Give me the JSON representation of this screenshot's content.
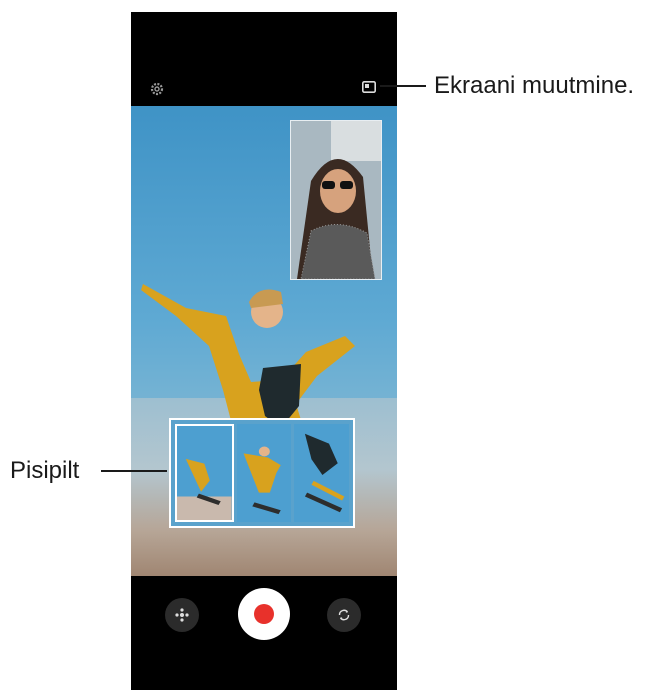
{
  "callouts": {
    "screen_switch": "Ekraani muutmine.",
    "thumbnail": "Pisipilt"
  },
  "icons": {
    "settings": "gear-icon",
    "screen_switch": "picture-in-picture-icon",
    "filter": "filter-icon",
    "record": "record-icon",
    "flip": "switch-camera-icon"
  },
  "colors": {
    "record": "#e8312b",
    "sky": "#3f93c6",
    "background": "#000000"
  }
}
